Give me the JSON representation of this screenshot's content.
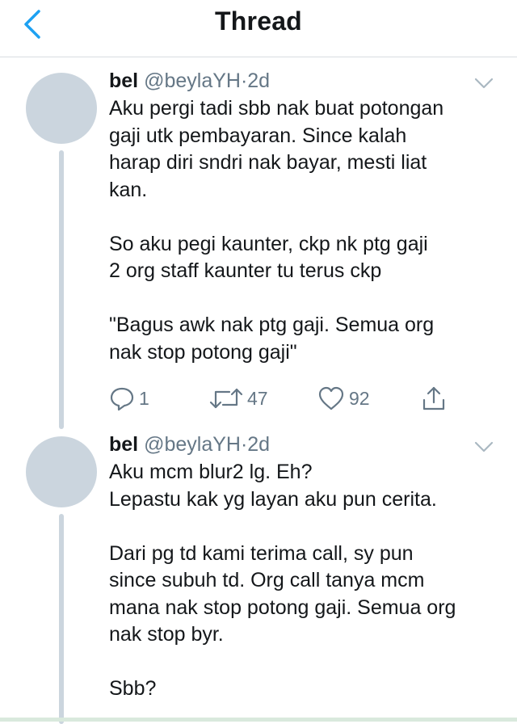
{
  "header": {
    "title": "Thread",
    "back_icon": "chevron-left-icon",
    "accent": "#1da1f2"
  },
  "tweets": [
    {
      "name": "bel",
      "handle": "@beylaYH",
      "dot": "·",
      "time": "2d",
      "text": "Aku pergi tadi sbb nak buat potongan\ngaji utk pembayaran. Since kalah\nharap diri sndri nak bayar, mesti liat\nkan.\n\nSo aku pegi kaunter, ckp nk ptg gaji\n2 org staff kaunter tu terus ckp\n\n\"Bagus awk nak ptg gaji. Semua org\nnak stop potong gaji\"",
      "replies": "1",
      "retweets": "47",
      "likes": "92"
    },
    {
      "name": "bel",
      "handle": "@beylaYH",
      "dot": "·",
      "time": "2d",
      "text": "Aku mcm blur2 lg. Eh?\nLepastu kak yg layan aku pun cerita.\n\nDari pg td kami terima call, sy pun\nsince subuh td. Org call tanya mcm\nmana nak stop potong gaji. Semua org\nnak stop byr.\n\nSbb?"
    }
  ],
  "colors": {
    "text": "#14171a",
    "secondary": "#657786",
    "avatar": "#cbd5de",
    "divider": "#d9dde1"
  }
}
